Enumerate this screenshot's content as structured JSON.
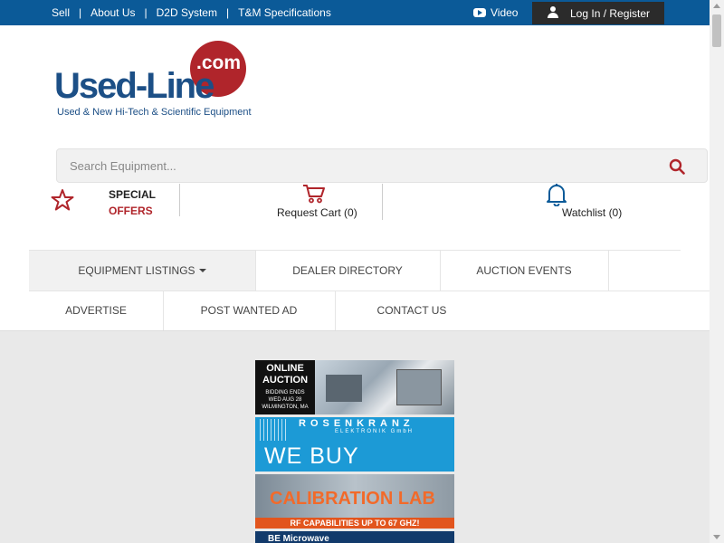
{
  "topbar": {
    "links": [
      "Sell",
      "About Us",
      "D2D System",
      "T&M Specifications"
    ],
    "video_label": "Video",
    "login_label": "Log In / Register"
  },
  "logo": {
    "word": "Used-Line",
    "com": ".com",
    "tagline": "Used & New Hi-Tech & Scientific Equipment"
  },
  "search": {
    "placeholder": "Search Equipment..."
  },
  "actions": {
    "special_line1": "SPECIAL",
    "special_line2": "OFFERS",
    "cart_label": "Request Cart (0)",
    "watchlist_label": "Watchlist (0)"
  },
  "nav": {
    "equipment": "EQUIPMENT LISTINGS",
    "dealer": "DEALER DIRECTORY",
    "auction": "AUCTION EVENTS",
    "advertise": "ADVERTISE",
    "wanted": "POST WANTED AD",
    "contact": "CONTACT US"
  },
  "banners": {
    "auction_title1": "ONLINE",
    "auction_title2": "AUCTION",
    "auction_line1": "BIDDING ENDS",
    "auction_line2": "WED AUG 28",
    "auction_line3": "WILMINGTON, MA",
    "rosenkranz": "ROSENKRANZ",
    "rosenkranz_sub": "ELEKTRONIK GmbH",
    "we_buy": "WE BUY",
    "calibration": "CALIBRATION LAB",
    "rf": "RF CAPABILITIES UP TO 67 GHZ!",
    "fourth": "BE Microwave"
  },
  "colors": {
    "topbar": "#0b5a98",
    "accent_red": "#b0252b",
    "logo_blue": "#1c4f86"
  }
}
